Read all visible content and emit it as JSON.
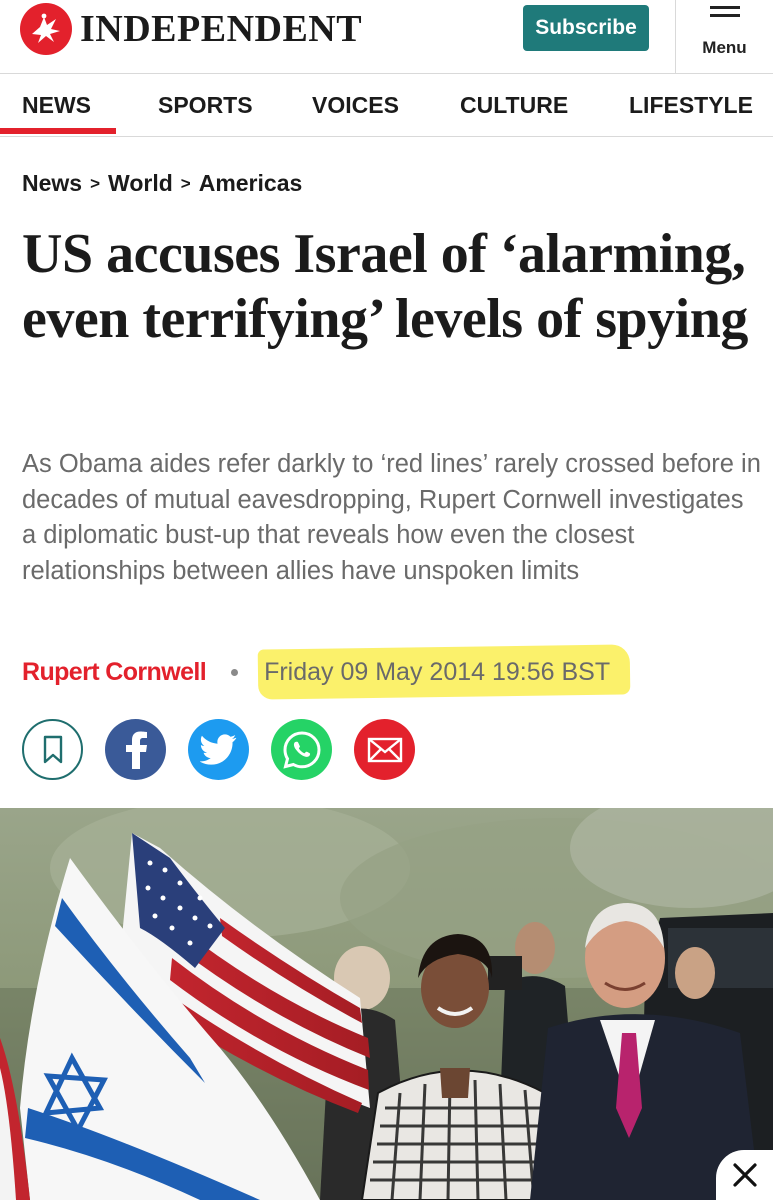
{
  "header": {
    "logo_text": "INDEPENDENT",
    "subscribe_label": "Subscribe",
    "menu_label": "Menu"
  },
  "nav": {
    "items": [
      {
        "label": "NEWS",
        "active": true
      },
      {
        "label": "SPORTS",
        "active": false
      },
      {
        "label": "VOICES",
        "active": false
      },
      {
        "label": "CULTURE",
        "active": false
      },
      {
        "label": "LIFESTYLE",
        "active": false
      }
    ]
  },
  "breadcrumb": {
    "items": [
      "News",
      "World",
      "Americas"
    ],
    "separator": ">"
  },
  "article": {
    "headline": "US accuses Israel of ‘alarming, even terrifying’ levels of spying",
    "standfirst": "As Obama aides refer darkly to ‘red lines’ rarely crossed before in decades of mutual eavesdropping, Rupert Cornwell investigates a diplomatic bust-up that reveals how even the closest relationships between allies have unspoken limits",
    "author": "Rupert Cornwell",
    "date": "Friday 09 May 2014 19:56 BST"
  },
  "share": {
    "icons": [
      "bookmark-icon",
      "facebook-icon",
      "twitter-icon",
      "whatsapp-icon",
      "email-icon"
    ]
  },
  "colors": {
    "brand_red": "#e3212c",
    "subscribe_teal": "#1f7a7a",
    "facebook": "#3a5a98",
    "twitter": "#1d9bf0",
    "whatsapp": "#25d366",
    "highlight": "#fbef5b"
  }
}
